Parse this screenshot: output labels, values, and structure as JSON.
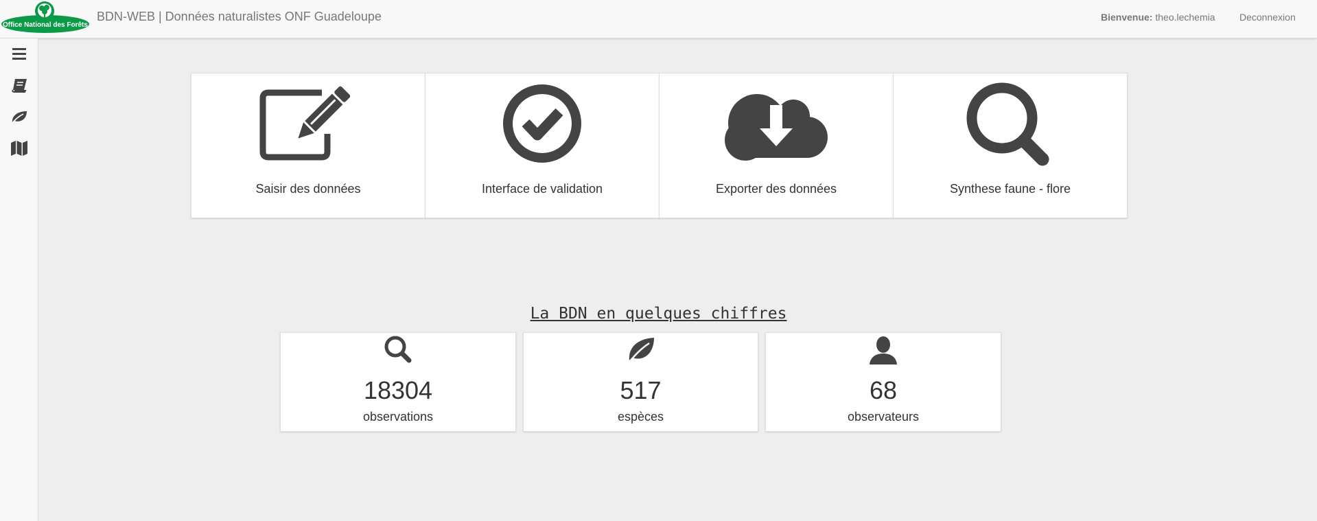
{
  "header": {
    "logo_text": "Office National des Forêts",
    "title": "BDN-WEB | Données naturalistes ONF Guadeloupe",
    "welcome_label": "Bienvenue:",
    "username": "theo.lechemia",
    "logout_label": "Deconnexion"
  },
  "sidebar": {
    "items": [
      {
        "icon": "menu-icon"
      },
      {
        "icon": "book-icon"
      },
      {
        "icon": "leaf-icon"
      },
      {
        "icon": "map-icon"
      }
    ]
  },
  "tiles": [
    {
      "label": "Saisir des données",
      "icon": "edit-icon"
    },
    {
      "label": "Interface de validation",
      "icon": "check-circle-icon"
    },
    {
      "label": "Exporter des données",
      "icon": "cloud-download-icon"
    },
    {
      "label": "Synthese faune - flore",
      "icon": "search-icon"
    }
  ],
  "stats": {
    "title": "La BDN en quelques chiffres",
    "items": [
      {
        "value": "18304",
        "caption": "observations",
        "icon": "search-icon"
      },
      {
        "value": "517",
        "caption": "espèces",
        "icon": "leaf-icon"
      },
      {
        "value": "68",
        "caption": "observateurs",
        "icon": "user-icon"
      }
    ]
  },
  "colors": {
    "icon": "#444444",
    "logo_green": "#0b9a48",
    "background": "#eeeeee"
  }
}
